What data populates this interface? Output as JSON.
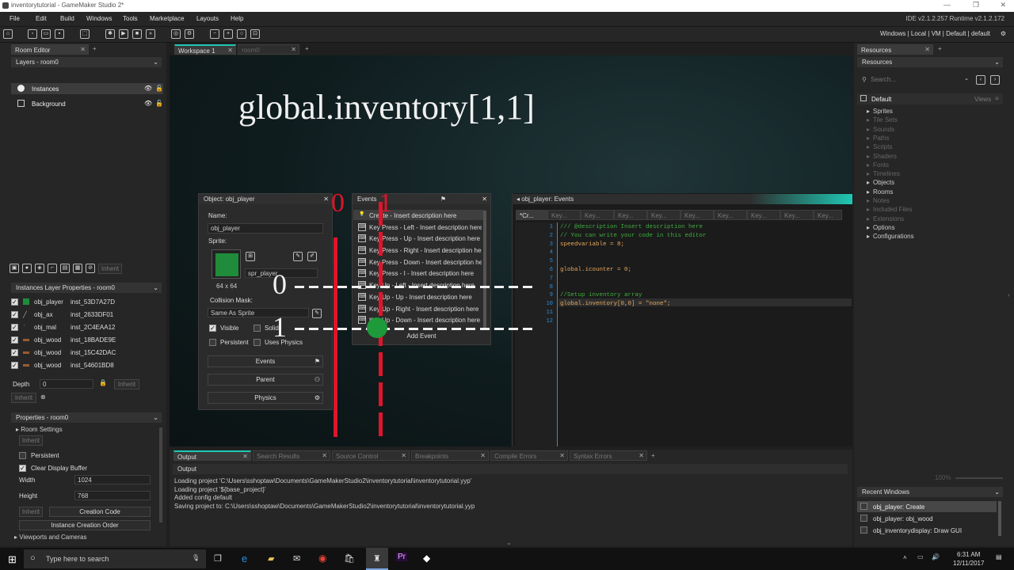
{
  "window": {
    "title": "inventorytutorial - GameMaker Studio 2*"
  },
  "menu": {
    "items": [
      "File",
      "Edit",
      "Build",
      "Windows",
      "Tools",
      "Marketplace",
      "Layouts",
      "Help"
    ],
    "ide_version": "IDE v2.1.2.257 Runtime v2.1.2.172"
  },
  "toolbar": {
    "target_profile": "Windows | Local | VM | Default | default"
  },
  "room_editor": {
    "tab": "Room Editor",
    "layers_header": "Layers - room0",
    "layers": [
      "Instances",
      "Background"
    ],
    "inherit_btn": "Inherit",
    "inst_props_header": "Instances Layer Properties - room0",
    "instances": [
      {
        "object": "obj_player",
        "id": "inst_53D7A27D"
      },
      {
        "object": "obj_ax",
        "id": "inst_2633DF01"
      },
      {
        "object": "obj_mal",
        "id": "inst_2C4EAA12"
      },
      {
        "object": "obj_wood",
        "id": "inst_18BADE9E"
      },
      {
        "object": "obj_wood",
        "id": "inst_15C42DAC"
      },
      {
        "object": "obj_wood",
        "id": "inst_54601BD8"
      }
    ],
    "depth_label": "Depth",
    "depth_value": "0",
    "inherit1": "Inherit",
    "inherit2": "Inherit",
    "properties_header": "Properties - room0",
    "room_settings": "Room Settings",
    "inherit3": "Inherit",
    "persistent": "Persistent",
    "clear_display": "Clear Display Buffer",
    "width_label": "Width",
    "width_value": "1024",
    "height_label": "Height",
    "height_value": "768",
    "inherit4": "Inherit",
    "creation_code": "Creation Code",
    "creation_order": "Instance Creation Order",
    "viewports": "Viewports and Cameras"
  },
  "workspace": {
    "tabs": [
      "Workspace 1",
      "room0"
    ],
    "overlay_text": "global.inventory[1,1]",
    "overlay_0a": "0",
    "overlay_1a": "1",
    "overlay_0b": "0",
    "overlay_1b": "1"
  },
  "object_panel": {
    "title": "Object: obj_player",
    "name_label": "Name:",
    "name_value": "obj_player",
    "sprite_label": "Sprite:",
    "sprite_name": "spr_player",
    "sprite_size": "64 x 64",
    "collision_label": "Collision Mask:",
    "collision_value": "Same As Sprite",
    "visible": "Visible",
    "solid": "Solid",
    "persistent": "Persistent",
    "uses_physics": "Uses Physics",
    "events_btn": "Events",
    "parent_btn": "Parent",
    "physics_btn": "Physics"
  },
  "events_panel": {
    "title": "Events",
    "items": [
      "Create - Insert description here",
      "Key Press - Left - Insert description here",
      "Key Press - Up - Insert description here",
      "Key Press - Right - Insert description here",
      "Key Press - Down - Insert description here",
      "Key Press - I - Insert description here",
      "Key Up - Left - Insert description here",
      "Key Up - Up - Insert description here",
      "Key Up - Right - Insert description here",
      "Key Up - Down - Insert description here"
    ],
    "add_event": "Add Event"
  },
  "code_panel": {
    "title": "obj_player: Events",
    "tabs": [
      "*Cr...",
      "Key...",
      "Key...",
      "Key...",
      "Key...",
      "Key...",
      "Key...",
      "Key...",
      "Key...",
      "Key..."
    ],
    "lines": [
      {
        "n": "1",
        "text": "/// @description Insert description here",
        "color": "#3fae3f"
      },
      {
        "n": "2",
        "text": "// You can write your code in this editor",
        "color": "#3fae3f"
      },
      {
        "n": "3",
        "text": "speedvariable = 8;",
        "color": "#e8a85a"
      },
      {
        "n": "4",
        "text": "",
        "color": "#ddd"
      },
      {
        "n": "5",
        "text": "",
        "color": "#ddd"
      },
      {
        "n": "6",
        "text": "global.icounter = 0;",
        "color": "#e8a85a"
      },
      {
        "n": "7",
        "text": "",
        "color": "#ddd"
      },
      {
        "n": "8",
        "text": "",
        "color": "#ddd"
      },
      {
        "n": "9",
        "text": "//Setup inventory array",
        "color": "#3fae3f"
      },
      {
        "n": "10",
        "text": "global.inventory[0,0] = \"none\";",
        "color": "#e8a85a"
      },
      {
        "n": "11",
        "text": "",
        "color": "#ddd"
      },
      {
        "n": "12",
        "text": "",
        "color": "#ddd"
      }
    ]
  },
  "resources": {
    "tab": "Resources",
    "header": "Resources",
    "search_placeholder": "Search...",
    "group": "Default",
    "views": "Views",
    "items": [
      {
        "name": "Sprites",
        "dim": false
      },
      {
        "name": "Tile Sets",
        "dim": true
      },
      {
        "name": "Sounds",
        "dim": true
      },
      {
        "name": "Paths",
        "dim": true
      },
      {
        "name": "Scripts",
        "dim": true
      },
      {
        "name": "Shaders",
        "dim": true
      },
      {
        "name": "Fonts",
        "dim": true
      },
      {
        "name": "Timelines",
        "dim": true
      },
      {
        "name": "Objects",
        "dim": false
      },
      {
        "name": "Rooms",
        "dim": false
      },
      {
        "name": "Notes",
        "dim": true
      },
      {
        "name": "Included Files",
        "dim": true
      },
      {
        "name": "Extensions",
        "dim": true
      },
      {
        "name": "Options",
        "dim": false
      },
      {
        "name": "Configurations",
        "dim": false
      }
    ],
    "zoom": "100%",
    "recent_header": "Recent Windows",
    "recent": [
      "obj_player: Create",
      "obj_player: obj_wood",
      "obj_inventorydisplay: Draw GUI"
    ]
  },
  "output": {
    "tabs": [
      "Output",
      "Search Results",
      "Source Control",
      "Breakpoints",
      "Compile Errors",
      "Syntax Errors"
    ],
    "header": "Output",
    "lines": [
      "Loading project 'C:\\Users\\sshoptaw\\Documents\\GameMakerStudio2\\inventorytutorial\\inventorytutorial.yyp'",
      "Loading project '${base_project}'",
      "Added config default",
      "Saving project to: C:\\Users\\sshoptaw\\Documents\\GameMakerStudio2\\inventorytutorial\\inventorytutorial.yyp"
    ]
  },
  "taskbar": {
    "search": "Type here to search",
    "time": "6:31 AM",
    "date": "12/11/2017"
  },
  "colors": {
    "accent": "#1ec8b4",
    "overlay_red": "#e0142a",
    "sprite_green": "#1e8c3a"
  }
}
